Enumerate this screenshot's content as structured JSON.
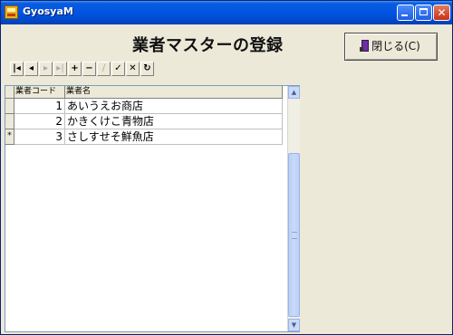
{
  "window": {
    "title": "GyosyaM",
    "minimize_label": "_",
    "close_label": "✕"
  },
  "form": {
    "heading": "業者マスターの登録",
    "close_button_label": "閉じる(C)",
    "close_button_icon": "door-exit-icon"
  },
  "navigator": {
    "buttons": [
      {
        "name": "first-record-button",
        "glyph": "|◂",
        "enabled": true
      },
      {
        "name": "prior-record-button",
        "glyph": "◂",
        "enabled": true
      },
      {
        "name": "next-record-button",
        "glyph": "▸",
        "enabled": false
      },
      {
        "name": "last-record-button",
        "glyph": "▸|",
        "enabled": false
      },
      {
        "name": "insert-record-button",
        "glyph": "+",
        "enabled": true
      },
      {
        "name": "delete-record-button",
        "glyph": "−",
        "enabled": true
      },
      {
        "name": "edit-record-button",
        "glyph": "∕",
        "enabled": false
      },
      {
        "name": "post-record-button",
        "glyph": "✓",
        "enabled": true
      },
      {
        "name": "cancel-record-button",
        "glyph": "✕",
        "enabled": true
      },
      {
        "name": "refresh-button",
        "glyph": "↻",
        "enabled": true
      }
    ]
  },
  "grid": {
    "columns": [
      "業者コード",
      "業者名"
    ],
    "rows": [
      {
        "indicator": "",
        "code": "1",
        "name": "あいうえお商店"
      },
      {
        "indicator": "",
        "code": "2",
        "name": "かきくけこ青物店"
      },
      {
        "indicator": "*",
        "code": "3",
        "name": "さしすせそ鮮魚店"
      }
    ]
  }
}
